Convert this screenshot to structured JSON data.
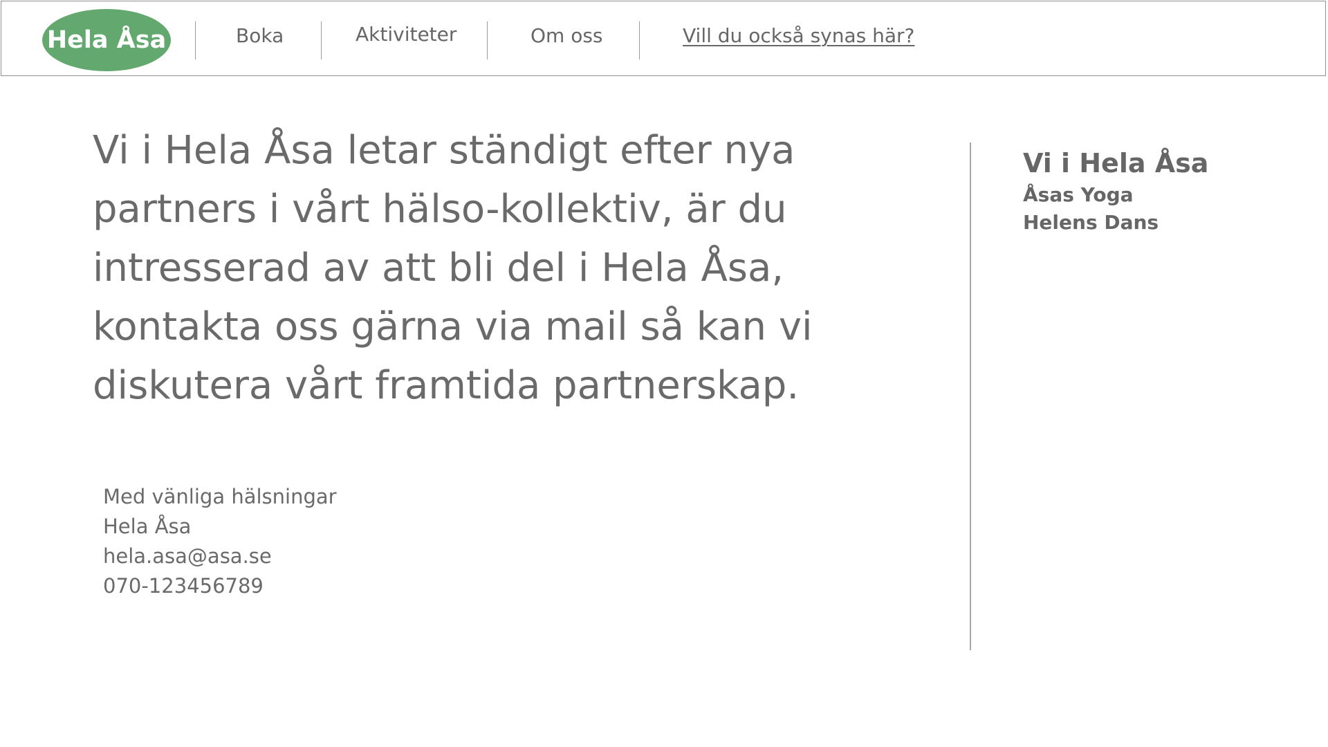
{
  "header": {
    "logo_text": "Hela Åsa",
    "nav": [
      {
        "label": "Boka"
      },
      {
        "label": "Aktiviteter"
      },
      {
        "label": "Om oss"
      },
      {
        "label": "Vill du också synas här?"
      }
    ]
  },
  "main": {
    "message": "Vi i Hela Åsa letar ständigt efter nya partners i vårt hälso-kollektiv, är du intresserad av att bli del i Hela Åsa, kontakta oss gärna via mail så kan vi diskutera vårt framtida partnerskap.",
    "signature": {
      "greeting": "Med vänliga hälsningar",
      "name": "Hela Åsa",
      "email": "hela.asa@asa.se",
      "phone": "070-123456789"
    }
  },
  "sidebar": {
    "title": "Vi i Hela Åsa",
    "items": [
      {
        "label": "Åsas Yoga"
      },
      {
        "label": "Helens Dans"
      }
    ]
  },
  "colors": {
    "brand_green": "#63a86e",
    "text_gray": "#6a6a6a",
    "divider_gray": "#9a9a9a"
  }
}
